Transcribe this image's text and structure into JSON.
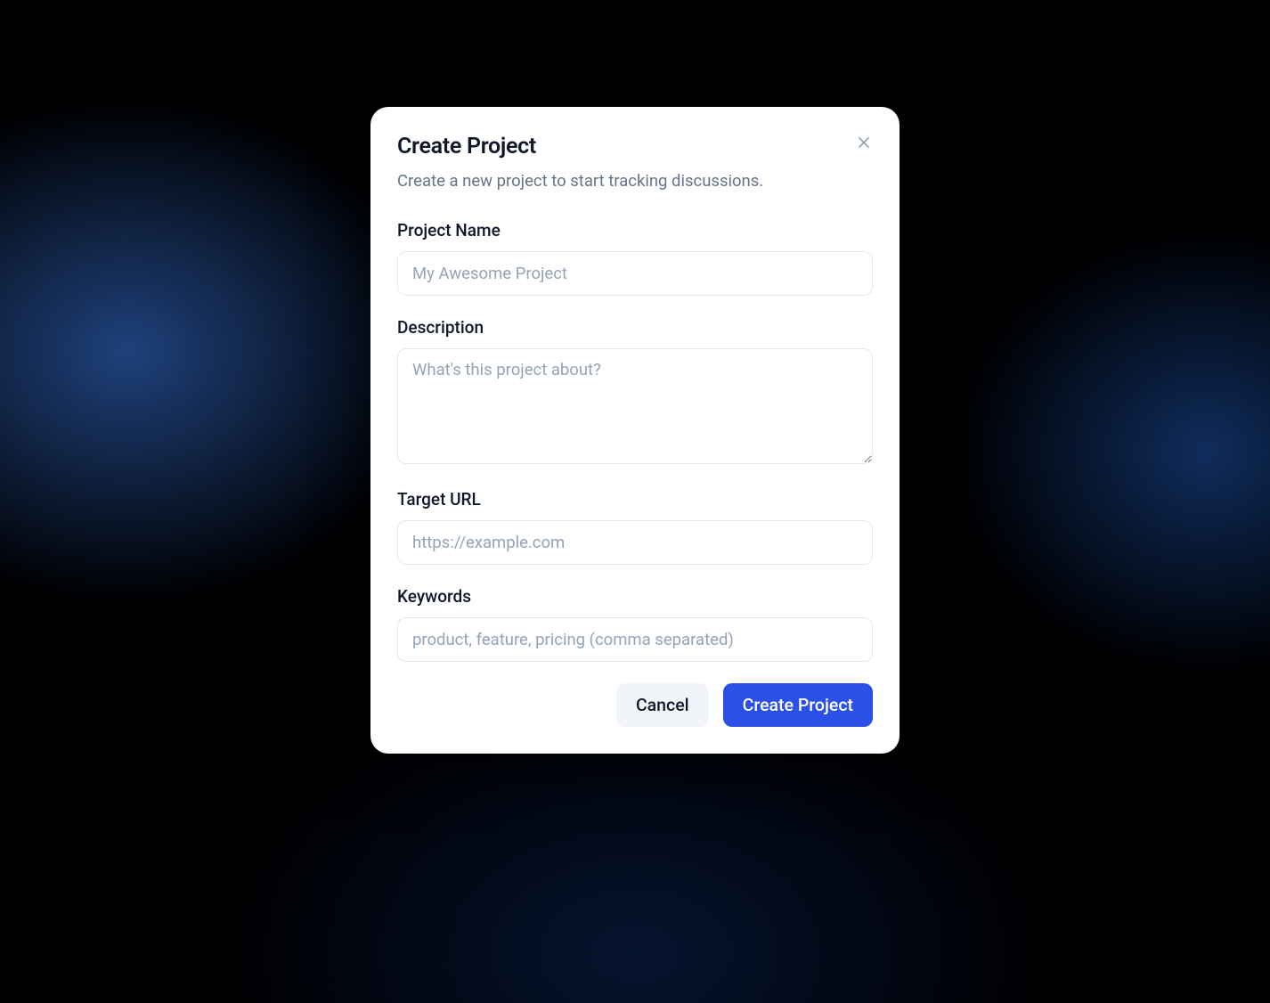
{
  "modal": {
    "title": "Create Project",
    "subtitle": "Create a new project to start tracking discussions.",
    "fields": {
      "project_name": {
        "label": "Project Name",
        "placeholder": "My Awesome Project",
        "value": ""
      },
      "description": {
        "label": "Description",
        "placeholder": "What's this project about?",
        "value": ""
      },
      "target_url": {
        "label": "Target URL",
        "placeholder": "https://example.com",
        "value": ""
      },
      "keywords": {
        "label": "Keywords",
        "placeholder": "product, feature, pricing (comma separated)",
        "value": ""
      }
    },
    "actions": {
      "cancel": "Cancel",
      "submit": "Create Project"
    }
  }
}
